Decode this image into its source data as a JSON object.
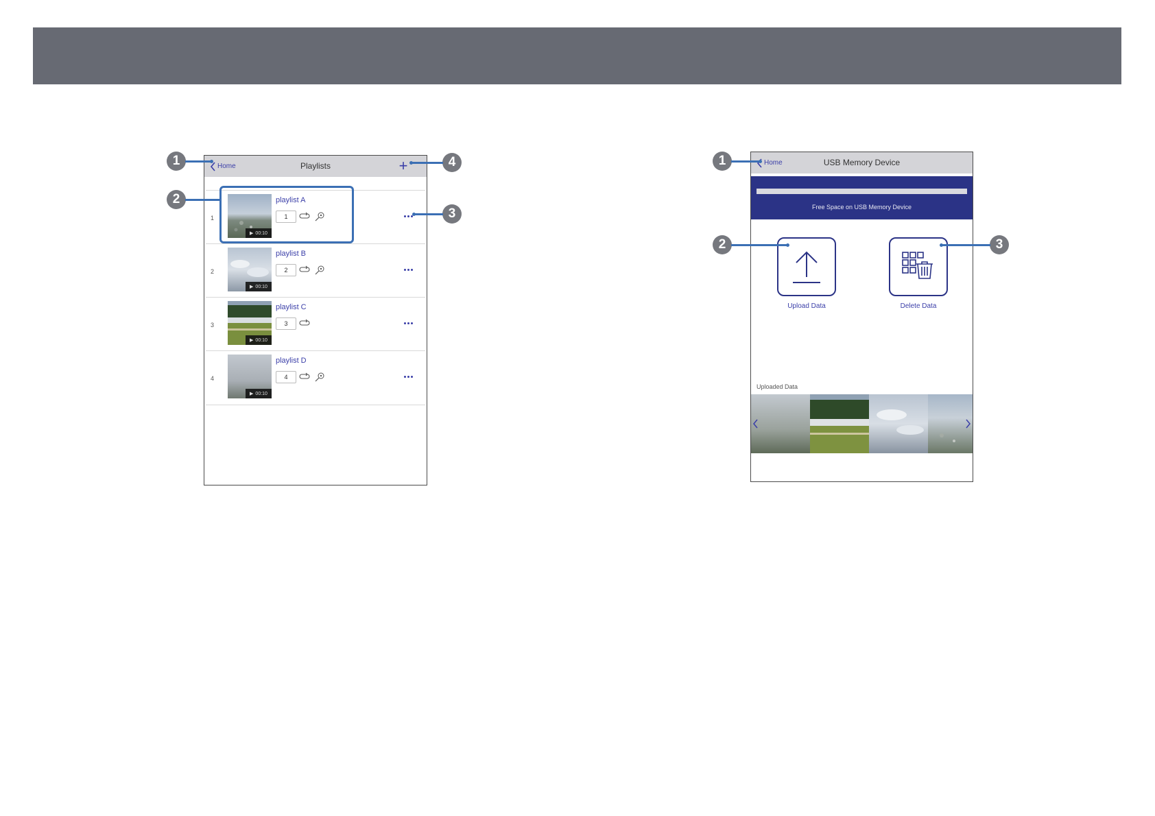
{
  "playlists_screen": {
    "back_label": "Home",
    "title": "Playlists",
    "add_symbol": "+",
    "rows": [
      {
        "index": "1",
        "name": "playlist A",
        "order": "1",
        "duration": "00:10",
        "has_effect": true
      },
      {
        "index": "2",
        "name": "playlist B",
        "order": "2",
        "duration": "00:10",
        "has_effect": true
      },
      {
        "index": "3",
        "name": "playlist C",
        "order": "3",
        "duration": "00:10",
        "has_effect": false
      },
      {
        "index": "4",
        "name": "playlist D",
        "order": "4",
        "duration": "00:10",
        "has_effect": true
      }
    ]
  },
  "usb_screen": {
    "back_label": "Home",
    "title": "USB Memory Device",
    "free_space_label": "Free Space on USB Memory Device",
    "upload_label": "Upload Data",
    "delete_label": "Delete Data",
    "uploaded_label": "Uploaded Data"
  },
  "callouts_left": [
    "1",
    "2",
    "3",
    "4"
  ],
  "callouts_right": [
    "1",
    "2",
    "3"
  ],
  "colors": {
    "banner": "#676a73",
    "accent": "#3a3ea8",
    "usb_header": "#2b3386",
    "callout_line": "#3b6fb4",
    "callout_badge": "#76787e"
  }
}
